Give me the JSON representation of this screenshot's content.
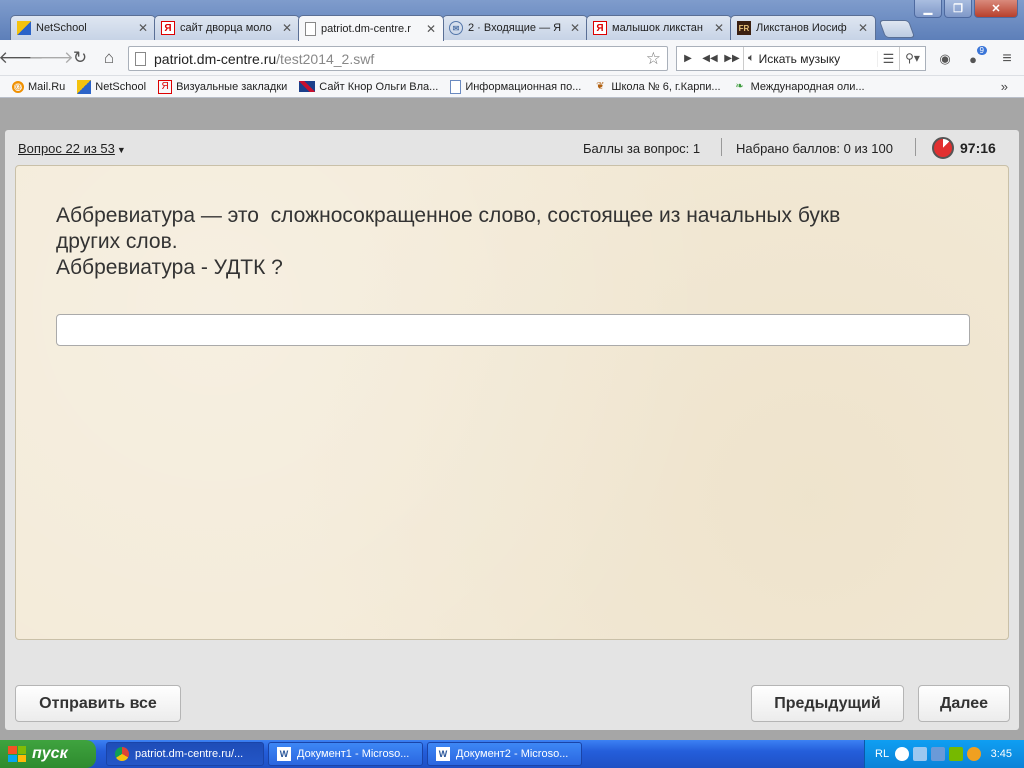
{
  "browser": {
    "tabs": [
      {
        "label": "NetSchool",
        "icon": "netschool-icon"
      },
      {
        "label": "сайт дворца моло",
        "icon": "yandex-icon"
      },
      {
        "label": "patriot.dm-centre.r",
        "icon": "page-icon",
        "active": true
      },
      {
        "label": "2 · Входящие — Я",
        "icon": "mail-icon"
      },
      {
        "label": "малышок ликстан",
        "icon": "yandex-icon"
      },
      {
        "label": "Ликстанов Иосиф",
        "icon": "fr-icon"
      }
    ],
    "url_host": "patriot.dm-centre.ru",
    "url_path": "/test2014_2.swf",
    "player_search_label": "Искать музыку",
    "ext_badge": "9",
    "bookmarks": [
      {
        "label": "Mail.Ru",
        "icon": "mailru-icon"
      },
      {
        "label": "NetSchool",
        "icon": "netschool-icon"
      },
      {
        "label": "Визуальные закладки",
        "icon": "yandex-icon"
      },
      {
        "label": "Сайт Кнор Ольги Вла...",
        "icon": "uk-flag-icon"
      },
      {
        "label": "Информационная по...",
        "icon": "doc-icon"
      },
      {
        "label": "Школа № 6, г.Карпи...",
        "icon": "school-icon"
      },
      {
        "label": "Международная оли...",
        "icon": "leaf-icon"
      }
    ],
    "bookmarks_more": "»"
  },
  "test": {
    "question_number": "Вопрос 22 из 53",
    "points_for_question": "Баллы за вопрос: 1",
    "total_points": "Набрано баллов: 0 из 100",
    "timer": "97:16",
    "question_lines": [
      "Аббревиатура — это  сложносокращенное слово, состоящее из начальных букв",
      "других слов.",
      "Аббревиатура - УДТК ?"
    ],
    "answer_value": "",
    "submit_all_label": "Отправить все",
    "prev_label": "Предыдущий",
    "next_label": "Далее"
  },
  "taskbar": {
    "start_label": "пуск",
    "tasks": [
      {
        "label": "patriot.dm-centre.ru/...",
        "icon": "chrome-icon"
      },
      {
        "label": "Документ1 - Microso...",
        "icon": "word-icon"
      },
      {
        "label": "Документ2 - Microso...",
        "icon": "word-icon"
      }
    ],
    "lang": "RL",
    "clock": "3:45"
  },
  "colors": {
    "panel_bg": "#f3ead7",
    "timer_red": "#e23030",
    "xp_blue": "#245edb",
    "start_green": "#3fa33f"
  }
}
